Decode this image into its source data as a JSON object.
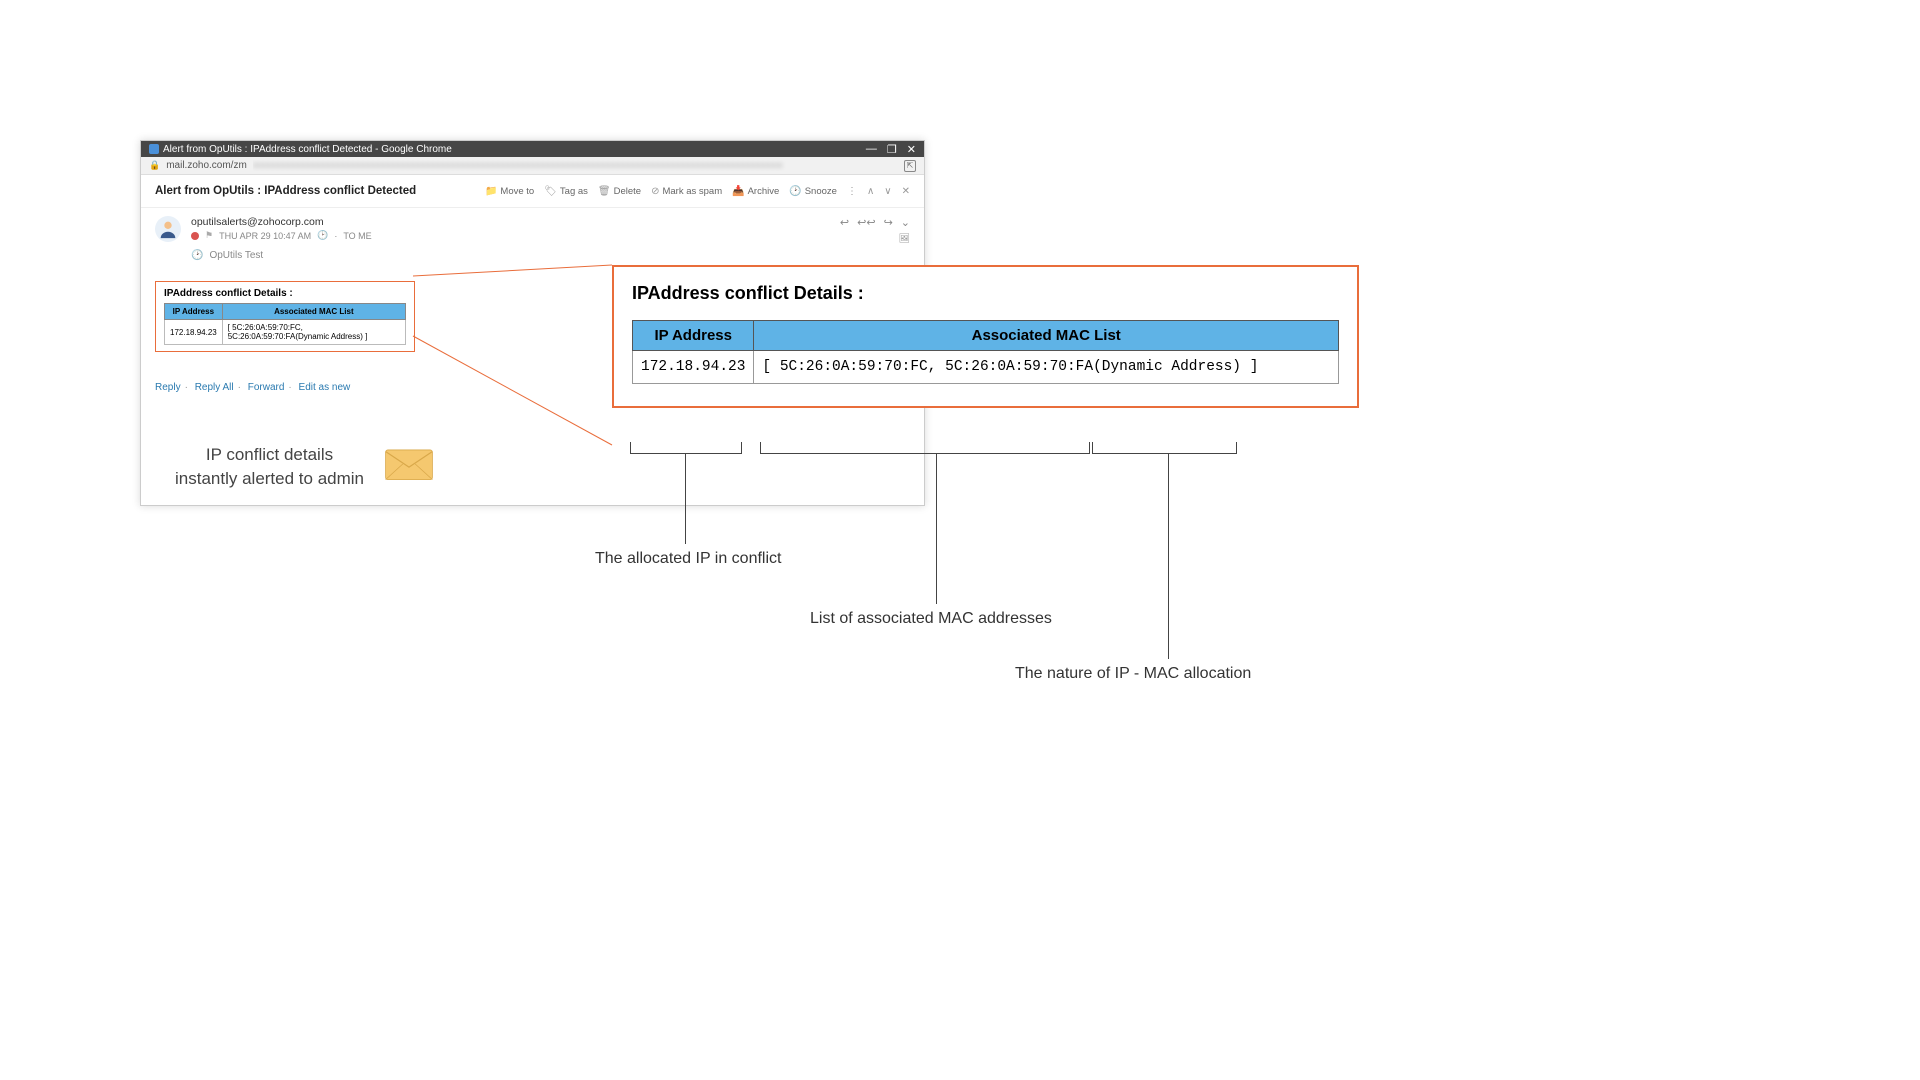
{
  "window": {
    "title": "Alert from OpUtils : IPAddress conflict Detected - Google Chrome",
    "url_host": "mail.zoho.com/zm",
    "url_blur": "xxxxxxxxxxxxxxxxxxxxxxxxxxxxxxxxxxxxxxxxxxxxxxxxxxxxxxxxxxxxxxxxxxxxxxxxxxxxxxxxxxxxxxxxxxxxxxxxxxxxxxxxxx"
  },
  "email": {
    "subject": "Alert from OpUtils : IPAddress conflict Detected",
    "toolbar": {
      "move": "Move to",
      "tag": "Tag as",
      "delete": "Delete",
      "spam": "Mark as spam",
      "archive": "Archive",
      "snooze": "Snooze"
    },
    "sender": "oputilsalerts@zohocorp.com",
    "date": "THU APR 29 10:47 AM",
    "to": "TO ME",
    "thread_label": "OpUtils Test",
    "reply_links": {
      "reply": "Reply",
      "reply_all": "Reply All",
      "forward": "Forward",
      "edit_new": "Edit as new"
    }
  },
  "details": {
    "title": "IPAddress conflict Details :",
    "col_ip": "IP Address",
    "col_mac": "Associated MAC List",
    "ip": "172.18.94.23",
    "macs": "[ 5C:26:0A:59:70:FC, 5C:26:0A:59:70:FA(Dynamic Address) ]"
  },
  "caption": {
    "line1": "IP conflict details",
    "line2": "instantly alerted to admin"
  },
  "annotations": {
    "a1": "The allocated IP in conflict",
    "a2": "List of associated MAC addresses",
    "a3": "The nature of IP - MAC allocation"
  }
}
